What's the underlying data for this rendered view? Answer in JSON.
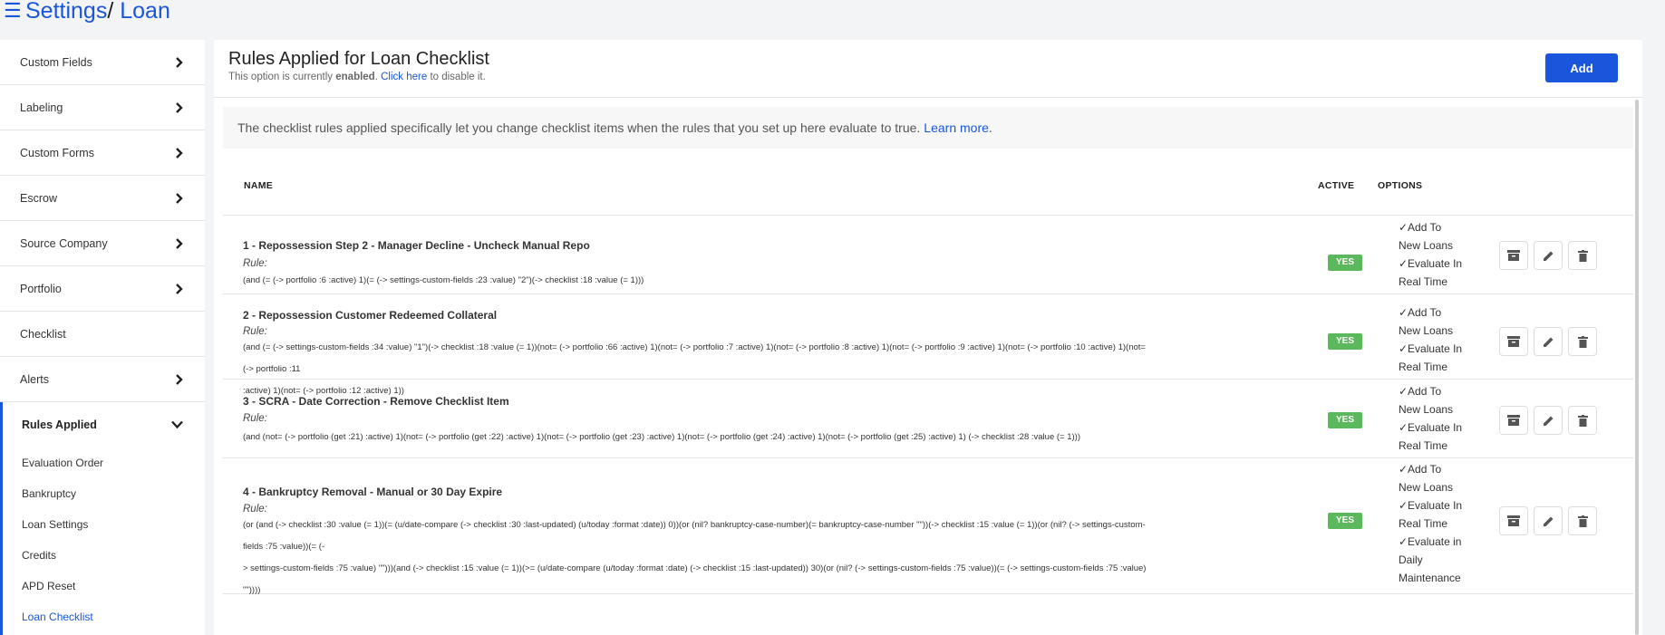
{
  "breadcrumb": {
    "menu_icon": "hamburger-icon",
    "root": "Settings",
    "separator": "/",
    "current": "Loan"
  },
  "sidebar": {
    "items": [
      {
        "label": "Custom Fields",
        "chevron": true
      },
      {
        "label": "Labeling",
        "chevron": true
      },
      {
        "label": "Custom Forms",
        "chevron": true
      },
      {
        "label": "Escrow",
        "chevron": true
      },
      {
        "label": "Source Company",
        "chevron": true
      },
      {
        "label": "Portfolio",
        "chevron": true
      },
      {
        "label": "Checklist",
        "chevron": false
      },
      {
        "label": "Alerts",
        "chevron": true
      }
    ],
    "group": {
      "label": "Rules Applied",
      "expanded": true,
      "sub_items": [
        "Evaluation Order",
        "Bankruptcy",
        "Loan Settings",
        "Credits",
        "APD Reset",
        "Loan Checklist"
      ],
      "active_sub": "Loan Checklist"
    }
  },
  "main": {
    "title": "Rules Applied for Loan Checklist",
    "status_prefix": "This option is currently ",
    "status_value": "enabled",
    "status_mid": ". ",
    "status_link": "Click here",
    "status_suffix": " to disable it.",
    "add_label": "Add",
    "info_text": "The checklist rules applied specifically let you change checklist items when the rules that you set up here evaluate to true.",
    "info_link": "Learn more",
    "info_end": "."
  },
  "table": {
    "headers": {
      "name": "NAME",
      "active": "ACTIVE",
      "options": "OPTIONS"
    },
    "rule_label": "Rule:",
    "rows": [
      {
        "name": "1 - Repossession Step 2 - Manager Decline - Uncheck Manual Repo",
        "expr_lines": [
          "(and (= (-> portfolio :6 :active) 1)(= (-> settings-custom-fields :23 :value) \"2\")(-> checklist :18 :value (= 1)))"
        ],
        "active": "YES",
        "options": [
          "✓Add To",
          "New Loans",
          "✓Evaluate In",
          "Real Time"
        ]
      },
      {
        "name": "2 - Repossession Customer Redeemed Collateral",
        "expr_lines": [
          "(and (= (-> settings-custom-fields :34 :value) \"1\")(-> checklist :18 :value (= 1))(not= (-> portfolio :66 :active) 1)(not= (-> portfolio :7 :active) 1)(not= (-> portfolio :8 :active) 1)(not= (-> portfolio :9 :active) 1)(not= (-> portfolio :10 :active) 1)(not= (-> portfolio :11",
          ":active) 1)(not= (-> portfolio :12 :active) 1))"
        ],
        "active": "YES",
        "options": [
          "✓Add To",
          "New Loans",
          "✓Evaluate In",
          "Real Time"
        ]
      },
      {
        "name": "3 - SCRA - Date Correction - Remove Checklist Item",
        "expr_lines": [
          "(and (not= (-> portfolio (get :21) :active) 1)(not= (-> portfolio (get :22) :active) 1)(not= (-> portfolio (get :23) :active) 1)(not= (-> portfolio (get :24) :active) 1)(not= (-> portfolio (get :25) :active) 1) (-> checklist :28 :value (= 1)))"
        ],
        "active": "YES",
        "options": [
          "✓Add To",
          "New Loans",
          "✓Evaluate In",
          "Real Time"
        ]
      },
      {
        "name": "4 - Bankruptcy Removal - Manual or 30 Day Expire",
        "expr_lines": [
          "(or (and (-> checklist :30 :value (= 1))(= (u/date-compare (-> checklist :30 :last-updated) (u/today :format :date)) 0))(or (nil? bankruptcy-case-number)(= bankruptcy-case-number \"\"))(-> checklist :15 :value (= 1))(or (nil? (-> settings-custom-fields :75 :value))(= (-",
          "> settings-custom-fields :75 :value) \"\")))(and (-> checklist :15 :value (= 1))(>= (u/date-compare (u/today :format :date) (-> checklist :15 :last-updated)) 30)(or (nil? (-> settings-custom-fields :75 :value))(= (-> settings-custom-fields :75 :value) \"\"))))"
        ],
        "active": "YES",
        "options": [
          "✓Add To",
          "New Loans",
          "✓Evaluate In",
          "Real Time",
          "✓Evaluate in",
          "Daily",
          "Maintenance"
        ]
      }
    ],
    "action_icons": [
      "archive-icon",
      "pencil-icon",
      "trash-icon"
    ]
  },
  "colors": {
    "accent": "#1a56db",
    "yes_badge": "#5cb85c",
    "background": "#f3f4f6"
  }
}
